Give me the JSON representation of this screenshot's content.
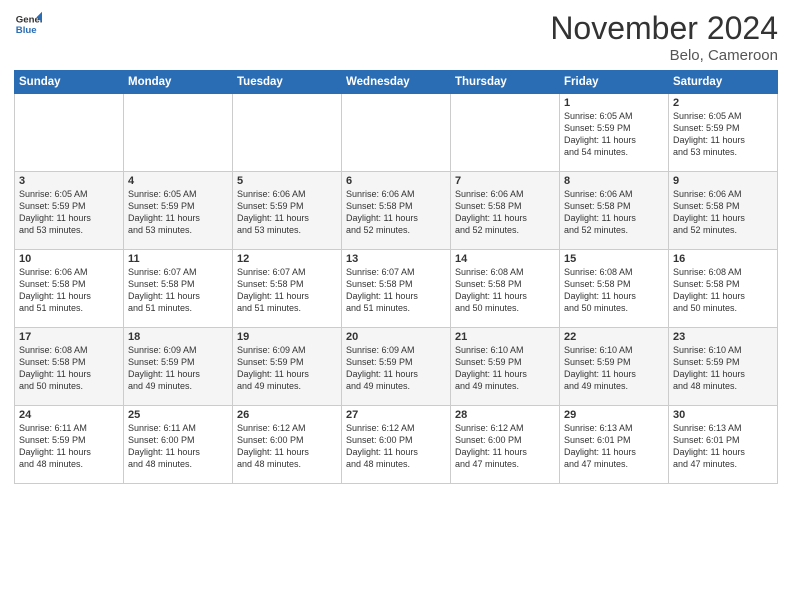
{
  "header": {
    "logo_general": "General",
    "logo_blue": "Blue",
    "month": "November 2024",
    "location": "Belo, Cameroon"
  },
  "weekdays": [
    "Sunday",
    "Monday",
    "Tuesday",
    "Wednesday",
    "Thursday",
    "Friday",
    "Saturday"
  ],
  "weeks": [
    [
      {
        "day": "",
        "info": ""
      },
      {
        "day": "",
        "info": ""
      },
      {
        "day": "",
        "info": ""
      },
      {
        "day": "",
        "info": ""
      },
      {
        "day": "",
        "info": ""
      },
      {
        "day": "1",
        "info": "Sunrise: 6:05 AM\nSunset: 5:59 PM\nDaylight: 11 hours\nand 54 minutes."
      },
      {
        "day": "2",
        "info": "Sunrise: 6:05 AM\nSunset: 5:59 PM\nDaylight: 11 hours\nand 53 minutes."
      }
    ],
    [
      {
        "day": "3",
        "info": "Sunrise: 6:05 AM\nSunset: 5:59 PM\nDaylight: 11 hours\nand 53 minutes."
      },
      {
        "day": "4",
        "info": "Sunrise: 6:05 AM\nSunset: 5:59 PM\nDaylight: 11 hours\nand 53 minutes."
      },
      {
        "day": "5",
        "info": "Sunrise: 6:06 AM\nSunset: 5:59 PM\nDaylight: 11 hours\nand 53 minutes."
      },
      {
        "day": "6",
        "info": "Sunrise: 6:06 AM\nSunset: 5:58 PM\nDaylight: 11 hours\nand 52 minutes."
      },
      {
        "day": "7",
        "info": "Sunrise: 6:06 AM\nSunset: 5:58 PM\nDaylight: 11 hours\nand 52 minutes."
      },
      {
        "day": "8",
        "info": "Sunrise: 6:06 AM\nSunset: 5:58 PM\nDaylight: 11 hours\nand 52 minutes."
      },
      {
        "day": "9",
        "info": "Sunrise: 6:06 AM\nSunset: 5:58 PM\nDaylight: 11 hours\nand 52 minutes."
      }
    ],
    [
      {
        "day": "10",
        "info": "Sunrise: 6:06 AM\nSunset: 5:58 PM\nDaylight: 11 hours\nand 51 minutes."
      },
      {
        "day": "11",
        "info": "Sunrise: 6:07 AM\nSunset: 5:58 PM\nDaylight: 11 hours\nand 51 minutes."
      },
      {
        "day": "12",
        "info": "Sunrise: 6:07 AM\nSunset: 5:58 PM\nDaylight: 11 hours\nand 51 minutes."
      },
      {
        "day": "13",
        "info": "Sunrise: 6:07 AM\nSunset: 5:58 PM\nDaylight: 11 hours\nand 51 minutes."
      },
      {
        "day": "14",
        "info": "Sunrise: 6:08 AM\nSunset: 5:58 PM\nDaylight: 11 hours\nand 50 minutes."
      },
      {
        "day": "15",
        "info": "Sunrise: 6:08 AM\nSunset: 5:58 PM\nDaylight: 11 hours\nand 50 minutes."
      },
      {
        "day": "16",
        "info": "Sunrise: 6:08 AM\nSunset: 5:58 PM\nDaylight: 11 hours\nand 50 minutes."
      }
    ],
    [
      {
        "day": "17",
        "info": "Sunrise: 6:08 AM\nSunset: 5:58 PM\nDaylight: 11 hours\nand 50 minutes."
      },
      {
        "day": "18",
        "info": "Sunrise: 6:09 AM\nSunset: 5:59 PM\nDaylight: 11 hours\nand 49 minutes."
      },
      {
        "day": "19",
        "info": "Sunrise: 6:09 AM\nSunset: 5:59 PM\nDaylight: 11 hours\nand 49 minutes."
      },
      {
        "day": "20",
        "info": "Sunrise: 6:09 AM\nSunset: 5:59 PM\nDaylight: 11 hours\nand 49 minutes."
      },
      {
        "day": "21",
        "info": "Sunrise: 6:10 AM\nSunset: 5:59 PM\nDaylight: 11 hours\nand 49 minutes."
      },
      {
        "day": "22",
        "info": "Sunrise: 6:10 AM\nSunset: 5:59 PM\nDaylight: 11 hours\nand 49 minutes."
      },
      {
        "day": "23",
        "info": "Sunrise: 6:10 AM\nSunset: 5:59 PM\nDaylight: 11 hours\nand 48 minutes."
      }
    ],
    [
      {
        "day": "24",
        "info": "Sunrise: 6:11 AM\nSunset: 5:59 PM\nDaylight: 11 hours\nand 48 minutes."
      },
      {
        "day": "25",
        "info": "Sunrise: 6:11 AM\nSunset: 6:00 PM\nDaylight: 11 hours\nand 48 minutes."
      },
      {
        "day": "26",
        "info": "Sunrise: 6:12 AM\nSunset: 6:00 PM\nDaylight: 11 hours\nand 48 minutes."
      },
      {
        "day": "27",
        "info": "Sunrise: 6:12 AM\nSunset: 6:00 PM\nDaylight: 11 hours\nand 48 minutes."
      },
      {
        "day": "28",
        "info": "Sunrise: 6:12 AM\nSunset: 6:00 PM\nDaylight: 11 hours\nand 47 minutes."
      },
      {
        "day": "29",
        "info": "Sunrise: 6:13 AM\nSunset: 6:01 PM\nDaylight: 11 hours\nand 47 minutes."
      },
      {
        "day": "30",
        "info": "Sunrise: 6:13 AM\nSunset: 6:01 PM\nDaylight: 11 hours\nand 47 minutes."
      }
    ]
  ]
}
